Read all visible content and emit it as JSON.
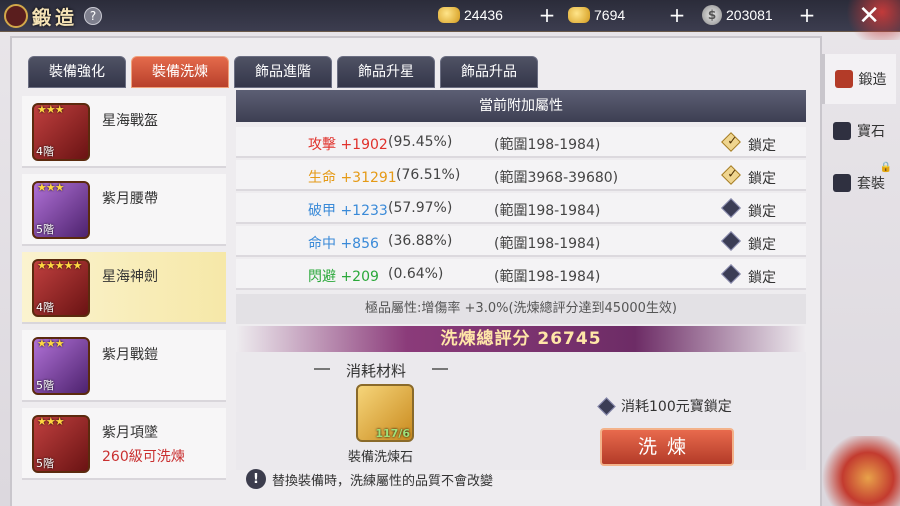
{
  "header": {
    "title": "鍛造",
    "help_label": "?",
    "currencies": [
      {
        "icon": "gold-ingot-icon",
        "value": "24436"
      },
      {
        "icon": "gold-bag-icon",
        "value": "7694"
      },
      {
        "icon": "silver-coin-icon",
        "value": "203081"
      }
    ],
    "close_label": "✕"
  },
  "tabs": [
    {
      "label": "裝備強化"
    },
    {
      "label": "裝備洗煉",
      "active": true
    },
    {
      "label": "飾品進階"
    },
    {
      "label": "飾品升星"
    },
    {
      "label": "飾品升品"
    }
  ],
  "items": [
    {
      "name": "星海戰盔",
      "stars": "★★★",
      "stage": "4階",
      "sub": ""
    },
    {
      "name": "紫月腰帶",
      "stars": "★★★",
      "stage": "5階",
      "sub": ""
    },
    {
      "name": "星海神劍",
      "stars": "★★★★★",
      "stage": "4階",
      "sub": "",
      "selected": true
    },
    {
      "name": "紫月戰鎧",
      "stars": "★★★",
      "stage": "5階",
      "sub": ""
    },
    {
      "name": "紫月項墜",
      "stars": "★★★",
      "stage": "5階",
      "sub": "260級可洗煉"
    }
  ],
  "attributes": {
    "header": "當前附加屬性",
    "rows": [
      {
        "name": "攻擊 +1902",
        "color": "#e0312b",
        "pct": "(95.45%)",
        "range": "(範圍198-1984)",
        "locked": true,
        "lock_label": "鎖定"
      },
      {
        "name": "生命 +31291",
        "color": "#e59a16",
        "pct": "(76.51%)",
        "range": "(範圍3968-39680)",
        "locked": true,
        "lock_label": "鎖定"
      },
      {
        "name": "破甲 +1233",
        "color": "#3a8ad8",
        "pct": "(57.97%)",
        "range": "(範圍198-1984)",
        "locked": false,
        "lock_label": "鎖定"
      },
      {
        "name": "命中 +856",
        "color": "#3a8ad8",
        "pct": "(36.88%)",
        "range": "(範圍198-1984)",
        "locked": false,
        "lock_label": "鎖定"
      },
      {
        "name": "閃避 +209",
        "color": "#2aa83a",
        "pct": "(0.64%)",
        "range": "(範圍198-1984)",
        "locked": false,
        "lock_label": "鎖定"
      }
    ],
    "bonus": "極品屬性:增傷率 +3.0%(洗煉總評分達到45000生效)",
    "score": "洗煉總評分 26745"
  },
  "materials": {
    "title": "消耗材料",
    "item_name": "裝備洗煉石",
    "count": "117/6"
  },
  "lock_cost": "消耗100元寶鎖定",
  "refine_button": "洗煉",
  "warning": "替換裝備時，洗練屬性的品質不會改變",
  "side_nav": [
    {
      "label": "鍛造",
      "active": true
    },
    {
      "label": "寶石"
    },
    {
      "label": "套裝",
      "locked": true
    }
  ]
}
